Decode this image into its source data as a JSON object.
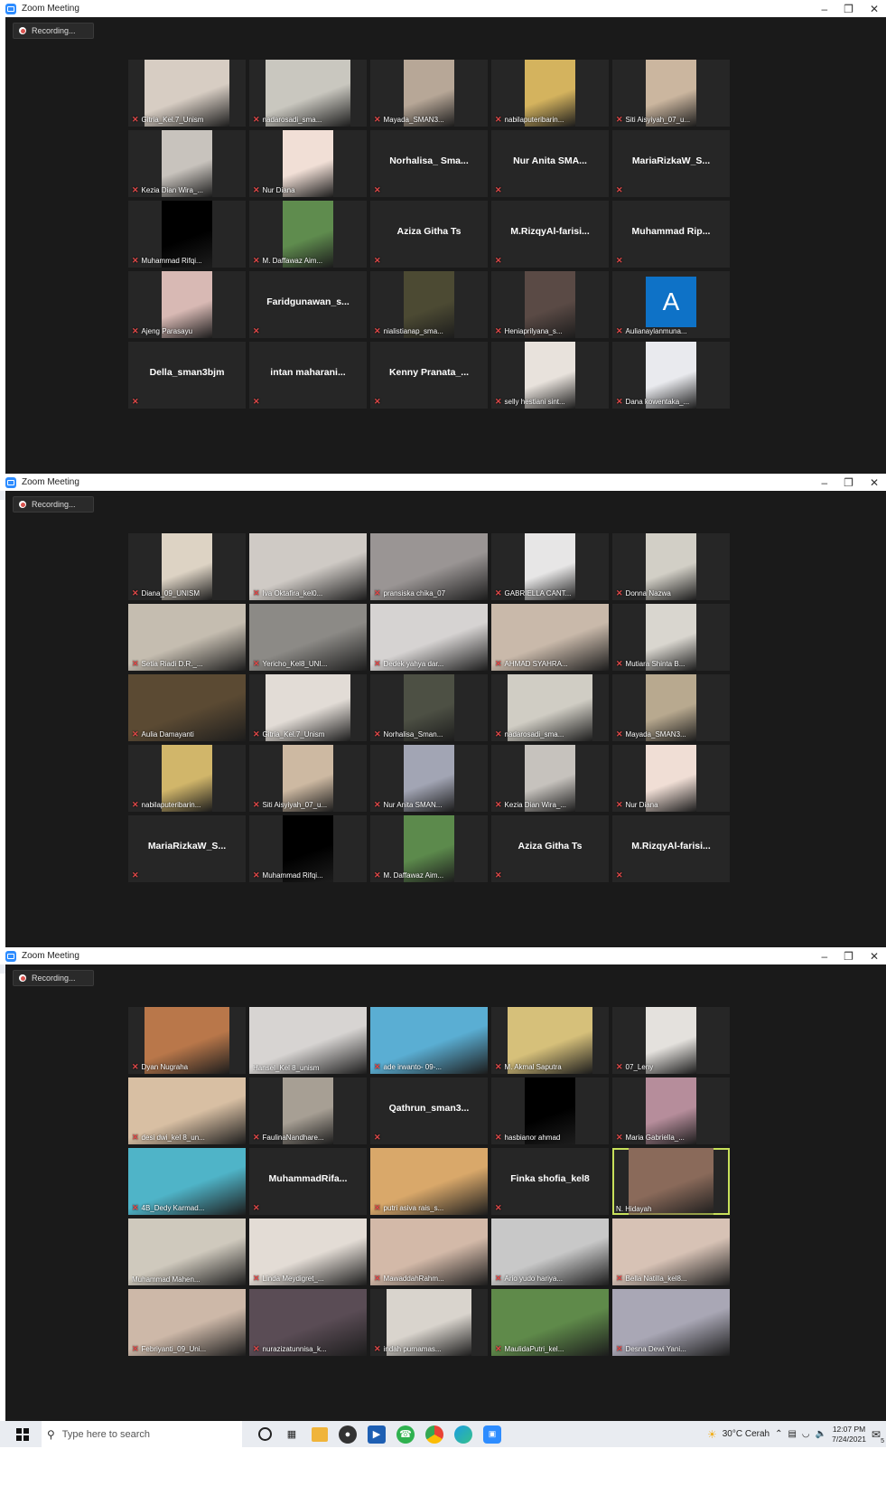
{
  "window": {
    "title": "Zoom Meeting",
    "recording_label": "Recording..."
  },
  "window_controls": [
    "minimize",
    "restore",
    "close"
  ],
  "taskbar": {
    "search_placeholder": "Type here to search",
    "weather": "30°C  Cerah",
    "time": "12:07 PM",
    "date": "7/24/2021",
    "notifications": "5"
  },
  "screens": [
    {
      "tiles": [
        {
          "name": "Gitria_Kel.7_Unism",
          "bg": "#d7cdc3",
          "type": "video",
          "fit": "wide",
          "mic": true
        },
        {
          "name": "nadarosadi_sma...",
          "bg": "#c9c7bf",
          "type": "video",
          "fit": "wide",
          "mic": true
        },
        {
          "name": "Mayada_SMAN3...",
          "bg": "#b7a797",
          "type": "video",
          "fit": "center",
          "mic": true
        },
        {
          "name": "nabilaputeribarin...",
          "bg": "#d4b35e",
          "type": "video",
          "fit": "center",
          "mic": true
        },
        {
          "name": "Siti Aisyiyah_07_u...",
          "bg": "#cbb69f",
          "type": "video",
          "fit": "center",
          "mic": true
        },
        {
          "name": "Kezia Dian Wira_...",
          "bg": "#c8c3bd",
          "type": "video",
          "fit": "center",
          "mic": true
        },
        {
          "name": "Nur Diana",
          "bg": "#f1dfd6",
          "type": "video",
          "fit": "center",
          "mic": true
        },
        {
          "name": "Norhalisa_ Sma...",
          "type": "name",
          "mic": true
        },
        {
          "name": "Nur Anita SMA...",
          "type": "name",
          "mic": true
        },
        {
          "name": "MariaRizkaW_S...",
          "type": "name",
          "mic": true
        },
        {
          "name": "Muhammad Rifqi...",
          "bg": "#000000",
          "type": "video",
          "fit": "center",
          "mic": true
        },
        {
          "name": "M. Daffawaz Aim...",
          "bg": "#5f8c4e",
          "type": "video",
          "fit": "center",
          "mic": true
        },
        {
          "name": "Aziza Githa Ts",
          "type": "name",
          "mic": true
        },
        {
          "name": "M.RizqyAl-farisi...",
          "type": "name",
          "mic": true
        },
        {
          "name": "Muhammad  Rip...",
          "type": "name",
          "mic": true
        },
        {
          "name": "Ajeng Parasayu",
          "bg": "#d8b9b4",
          "type": "video",
          "fit": "center",
          "mic": true
        },
        {
          "name": "Faridgunawan_s...",
          "type": "name",
          "mic": true
        },
        {
          "name": "nialistianap_sma...",
          "bg": "#4c4a33",
          "type": "video",
          "fit": "center",
          "mic": true
        },
        {
          "name": "Heniaprilyana_s...",
          "bg": "#5a4a45",
          "type": "video",
          "fit": "center",
          "mic": true
        },
        {
          "name": "Aulianaylanmuna...",
          "type": "avatar",
          "letter": "A",
          "mic": true
        },
        {
          "name": "Della_sman3bjm",
          "type": "name",
          "mic": true
        },
        {
          "name": "intan  maharani...",
          "type": "name",
          "mic": true
        },
        {
          "name": "Kenny  Pranata_...",
          "type": "name",
          "mic": true
        },
        {
          "name": "selly hestiani sint...",
          "bg": "#e8e2dc",
          "type": "video",
          "fit": "center",
          "mic": true
        },
        {
          "name": "Dana kowentaka_...",
          "bg": "#e9eaee",
          "type": "video",
          "fit": "center",
          "mic": true
        }
      ]
    },
    {
      "tiles": [
        {
          "name": "Diana_09_UNISM",
          "bg": "#ddd3c4",
          "type": "video",
          "fit": "center",
          "mic": true
        },
        {
          "name": "Iva Oktafira_kel0...",
          "bg": "#cfcac5",
          "type": "video",
          "fit": "full",
          "mic": true
        },
        {
          "name": "pransiska chika_07",
          "bg": "#9a9594",
          "type": "video",
          "fit": "full",
          "mic": true
        },
        {
          "name": "GABRIELLA CANT...",
          "bg": "#e7e6e6",
          "type": "video",
          "fit": "center",
          "mic": true
        },
        {
          "name": "Donna Nazwa",
          "bg": "#d2cfc6",
          "type": "video",
          "fit": "center",
          "mic": true
        },
        {
          "name": "Setia Riadi D.R._...",
          "bg": "#c5bdb0",
          "type": "video",
          "fit": "full",
          "mic": true
        },
        {
          "name": "Yericho_Kel8_UNI...",
          "bg": "#8c8a86",
          "type": "video",
          "fit": "full",
          "mic": true
        },
        {
          "name": "Dedek yahya dar...",
          "bg": "#d6d3d2",
          "type": "video",
          "fit": "full",
          "mic": true
        },
        {
          "name": "AHMAD SYAHRA...",
          "bg": "#c9b9aa",
          "type": "video",
          "fit": "full",
          "mic": true
        },
        {
          "name": "Mutiara Shinta B...",
          "bg": "#d9d6cf",
          "type": "video",
          "fit": "center",
          "mic": true
        },
        {
          "name": "Aulia Damayanti",
          "bg": "#5b4a33",
          "type": "video",
          "fit": "full",
          "mic": true
        },
        {
          "name": "Gitria_Kel.7_Unism",
          "bg": "#e2dcd6",
          "type": "video",
          "fit": "wide",
          "mic": true
        },
        {
          "name": "Norhalisa_Sman...",
          "bg": "#4d5044",
          "type": "video",
          "fit": "center",
          "mic": true
        },
        {
          "name": "nadarosadi_sma...",
          "bg": "#d0cdc4",
          "type": "video",
          "fit": "wide",
          "mic": true
        },
        {
          "name": "Mayada_SMAN3...",
          "bg": "#b8a98f",
          "type": "video",
          "fit": "center",
          "mic": true
        },
        {
          "name": "nabilaputeribarin...",
          "bg": "#d1b66a",
          "type": "video",
          "fit": "center",
          "mic": true
        },
        {
          "name": "Siti Aisyiyah_07_u...",
          "bg": "#cdb9a2",
          "type": "video",
          "fit": "center",
          "mic": true
        },
        {
          "name": "Nur Anita SMAN...",
          "bg": "#a2a5b4",
          "type": "video",
          "fit": "center",
          "mic": true
        },
        {
          "name": "Kezia Dian Wira_...",
          "bg": "#c6c2bd",
          "type": "video",
          "fit": "center",
          "mic": true
        },
        {
          "name": "Nur Diana",
          "bg": "#f0ded5",
          "type": "video",
          "fit": "center",
          "mic": true
        },
        {
          "name": "MariaRizkaW_S...",
          "type": "name",
          "mic": true
        },
        {
          "name": "Muhammad Rifqi...",
          "bg": "#000000",
          "type": "video",
          "fit": "center",
          "mic": true
        },
        {
          "name": "M. Daffawaz Aim...",
          "bg": "#5c8a4c",
          "type": "video",
          "fit": "center",
          "mic": true
        },
        {
          "name": "Aziza Githa Ts",
          "type": "name",
          "mic": true
        },
        {
          "name": "M.RizqyAl-farisi...",
          "type": "name",
          "mic": true
        }
      ]
    },
    {
      "tiles": [
        {
          "name": "Dyan Nugraha",
          "bg": "#b9774a",
          "type": "video",
          "fit": "wide",
          "mic": true
        },
        {
          "name": "Hansel_Kel 8_unism",
          "bg": "#d7d4d2",
          "type": "video",
          "fit": "full",
          "mic": false
        },
        {
          "name": "ade irwanto- 09-...",
          "bg": "#5aaed3",
          "type": "video",
          "fit": "full",
          "mic": true
        },
        {
          "name": "M. Akmal Saputra",
          "bg": "#d6c07a",
          "type": "video",
          "fit": "wide",
          "mic": true
        },
        {
          "name": "07_Leny",
          "bg": "#e4e1dd",
          "type": "video",
          "fit": "center",
          "mic": true
        },
        {
          "name": "desi dwi_kel 8_un...",
          "bg": "#d8bfa3",
          "type": "video",
          "fit": "full",
          "mic": true
        },
        {
          "name": "FaulinaNandhare...",
          "bg": "#a79f94",
          "type": "video",
          "fit": "center",
          "mic": true
        },
        {
          "name": "Qathrun_sman3...",
          "type": "name",
          "mic": true
        },
        {
          "name": "hasbianor ahmad",
          "bg": "#000000",
          "type": "video",
          "fit": "center",
          "mic": true
        },
        {
          "name": "Maria Gabriella_...",
          "bg": "#b68d9b",
          "type": "video",
          "fit": "center",
          "mic": true
        },
        {
          "name": "4B_Dedy Karmad...",
          "bg": "#4fb4c8",
          "type": "video",
          "fit": "full",
          "mic": true
        },
        {
          "name": "MuhammadRifa...",
          "type": "name",
          "mic": true
        },
        {
          "name": "putri asiva rais_s...",
          "bg": "#d9a86a",
          "type": "video",
          "fit": "full",
          "mic": true
        },
        {
          "name": "Finka shofia_kel8",
          "type": "name",
          "mic": true
        },
        {
          "name": "N. Hidayah",
          "bg": "#8a6a5a",
          "type": "video",
          "fit": "wide",
          "mic": false,
          "talking": true
        },
        {
          "name": "Muhammad Mahen...",
          "bg": "#cfc9bd",
          "type": "video",
          "fit": "full",
          "mic": false
        },
        {
          "name": "Linda Meydigret_...",
          "bg": "#e3dcd5",
          "type": "video",
          "fit": "full",
          "mic": true
        },
        {
          "name": "MawaddahRahm...",
          "bg": "#d3b9a8",
          "type": "video",
          "fit": "full",
          "mic": true
        },
        {
          "name": "Ario yudo hariya...",
          "bg": "#c8c8c8",
          "type": "video",
          "fit": "full",
          "mic": true
        },
        {
          "name": "Bella Natilla_kel8...",
          "bg": "#d7c2b5",
          "type": "video",
          "fit": "full",
          "mic": true
        },
        {
          "name": "Febriyanti_09_Uni...",
          "bg": "#cdb8a8",
          "type": "video",
          "fit": "full",
          "mic": true
        },
        {
          "name": "nurazizatunnisa_k...",
          "bg": "#5a4c55",
          "type": "video",
          "fit": "full",
          "mic": true
        },
        {
          "name": "indah purnamas...",
          "bg": "#d9d4cd",
          "type": "video",
          "fit": "wide",
          "mic": true
        },
        {
          "name": "MaulidaPutri_kel...",
          "bg": "#5f8a4a",
          "type": "video",
          "fit": "full",
          "mic": true
        },
        {
          "name": "Desna Dewi Yani...",
          "bg": "#a9a7b5",
          "type": "video",
          "fit": "full",
          "mic": true
        }
      ]
    }
  ]
}
